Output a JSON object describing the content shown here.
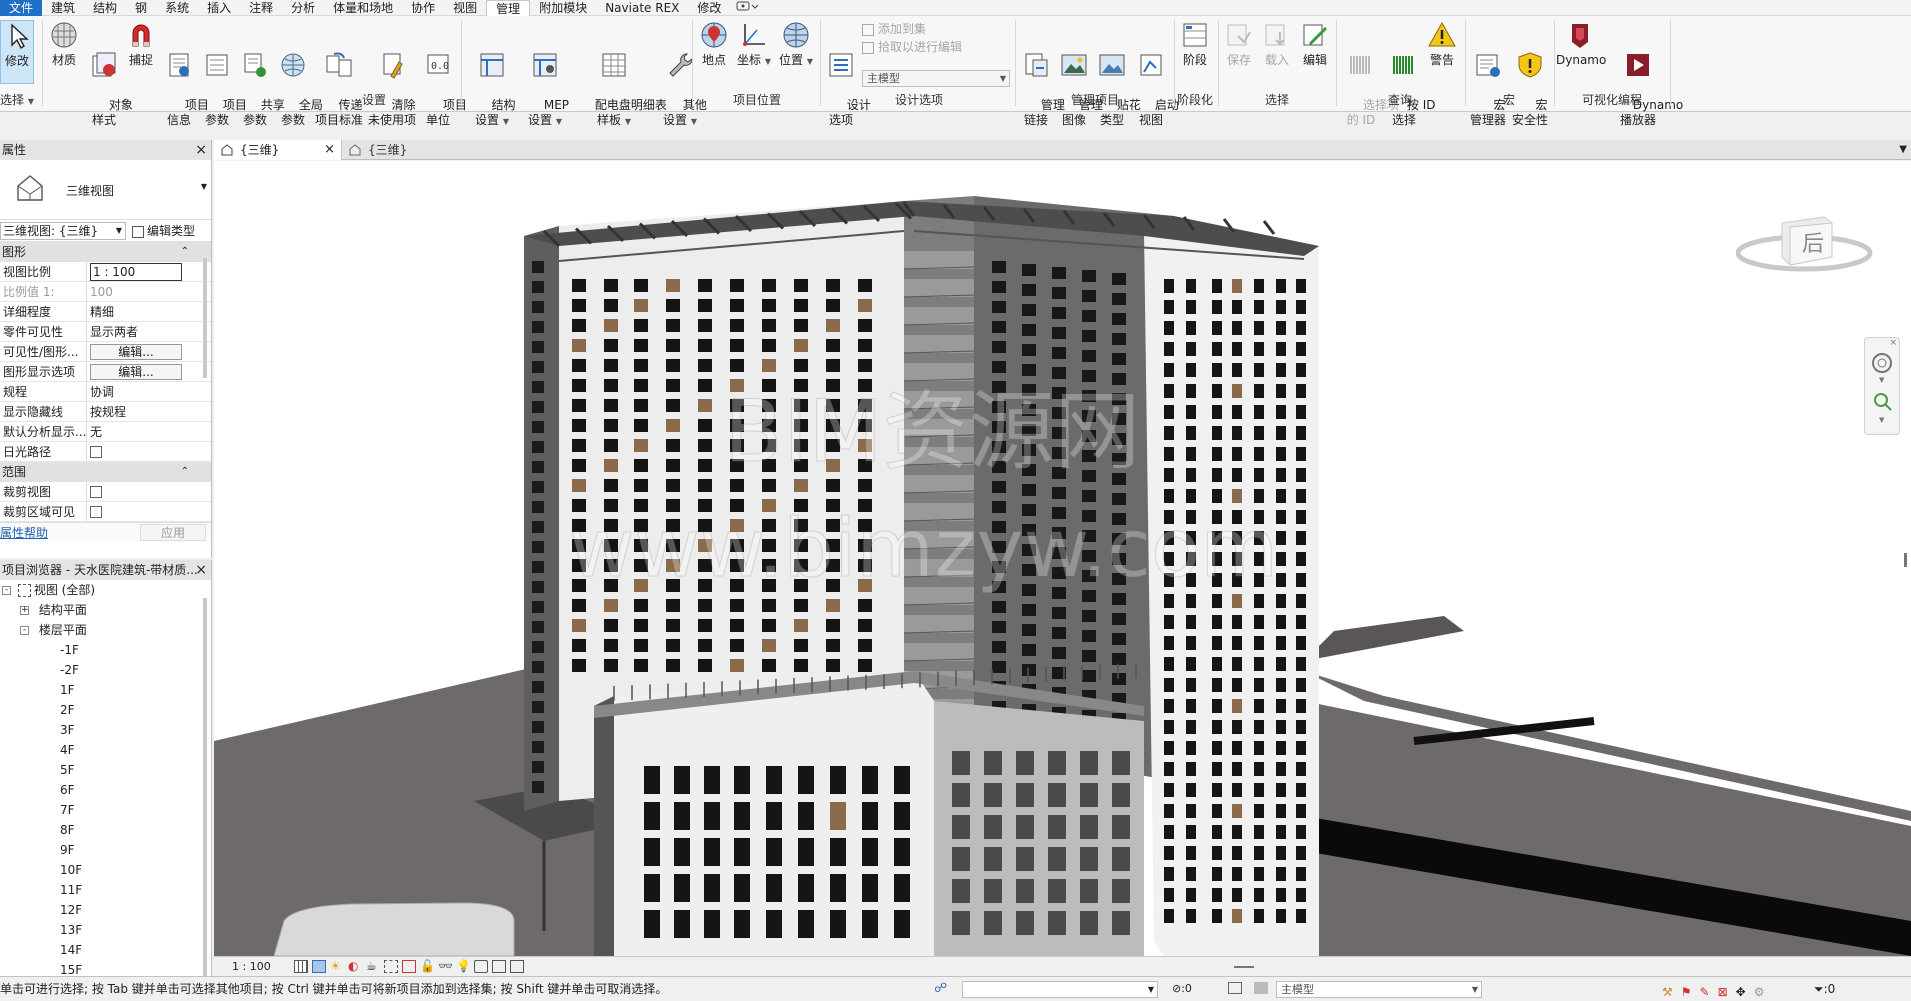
{
  "menu": {
    "tabs": [
      "文件",
      "建筑",
      "结构",
      "钢",
      "系统",
      "插入",
      "注释",
      "分析",
      "体量和场地",
      "协作",
      "视图",
      "管理",
      "附加模块",
      "Naviate REX",
      "修改"
    ],
    "active_tab": "管理"
  },
  "ribbon": {
    "select": {
      "modify": "修改",
      "group": "选择"
    },
    "settings": {
      "buttons": {
        "material": "材质",
        "object_style": "对象\n样式",
        "snap": "捕捉",
        "project_info": "项目\n信息",
        "project_params": "项目\n参数",
        "shared_params": "共享\n参数",
        "global_params": "全局\n参数",
        "transfer_standards": "传递\n项目标准",
        "purge_unused": "清除\n未使用项",
        "project_units": "项目\n单位",
        "structural_settings": "结构\n设置",
        "mep_settings": "MEP\n设置",
        "panel_schedule": "配电盘明细表\n样板",
        "other_settings": "其他\n设置"
      },
      "group": "设置"
    },
    "project_location": {
      "buttons": {
        "location": "地点",
        "coordinates": "坐标",
        "position": "位置"
      },
      "group": "项目位置"
    },
    "design_options": {
      "options": "设计\n选项",
      "add_to_set": "添加到集",
      "pick_to_edit": "拾取以进行编辑",
      "main_model": "主模型",
      "group": "设计选项"
    },
    "manage_project": {
      "buttons": {
        "manage_links": "管理\n链接",
        "manage_images": "管理\n图像",
        "decal_types": "贴花\n类型",
        "starting_view": "启动\n视图"
      },
      "group": "管理项目"
    },
    "phasing": {
      "phases": "阶段",
      "group": "阶段化"
    },
    "selection": {
      "save": "保存",
      "load": "载入",
      "edit": "编辑",
      "group": "选择"
    },
    "inquiry": {
      "ids_of_selection": "选择项\n的 ID",
      "select_by_id": "按 ID\n选择",
      "warnings": "警告",
      "group": "查询"
    },
    "macros": {
      "macro_manager": "宏\n管理器",
      "macro_security": "宏\n安全性",
      "group": "宏"
    },
    "visual_programming": {
      "dynamo": "Dynamo",
      "dynamo_player": "Dynamo\n播放器",
      "group": "可视化编程"
    }
  },
  "view_tabs": [
    {
      "label": "{三维}",
      "active": true
    },
    {
      "label": "{三维}",
      "active": false
    }
  ],
  "properties": {
    "title": "属性",
    "type_name": "三维视图",
    "instance_selector": "三维视图: {三维}",
    "edit_type": "编辑类型",
    "sections": {
      "graphics": "图形",
      "extents": "范围"
    },
    "rows": [
      {
        "key": "视图比例",
        "value": "1 : 100"
      },
      {
        "key": "比例值 1:",
        "value": "100"
      },
      {
        "key": "详细程度",
        "value": "精细"
      },
      {
        "key": "零件可见性",
        "value": "显示两者"
      },
      {
        "key": "可见性/图形...",
        "value": "编辑..."
      },
      {
        "key": "图形显示选项",
        "value": "编辑..."
      },
      {
        "key": "规程",
        "value": "协调"
      },
      {
        "key": "显示隐藏线",
        "value": "按规程"
      },
      {
        "key": "默认分析显示...",
        "value": "无"
      },
      {
        "key": "日光路径",
        "value": ""
      }
    ],
    "extent_rows": [
      {
        "key": "裁剪视图",
        "value": ""
      },
      {
        "key": "裁剪区域可见",
        "value": ""
      }
    ],
    "help": "属性帮助",
    "apply": "应用"
  },
  "browser": {
    "title": "项目浏览器 - 天水医院建筑-带材质...",
    "root": "视图 (全部)",
    "structural_plans": "结构平面",
    "floor_plans": "楼层平面",
    "levels": [
      "-1F",
      "-2F",
      "1F",
      "2F",
      "3F",
      "4F",
      "5F",
      "6F",
      "7F",
      "8F",
      "9F",
      "10F",
      "11F",
      "12F",
      "13F",
      "14F",
      "15F"
    ]
  },
  "canvas": {
    "watermark_line1": "BIM资源网",
    "watermark_line2": "www.bimzyw.com",
    "viewcube_face": "后"
  },
  "view_control": {
    "scale": "1 : 100"
  },
  "status": {
    "hint": "单击可进行选择; 按 Tab 键并单击可选择其他项目; 按 Ctrl 键并单击可将新项目添加到选择集; 按 Shift 键并单击可取消选择。",
    "zero_a": ":0",
    "main_model": "主模型",
    "filter_count": ":0"
  },
  "colors": {
    "file_tab": "#1e6fc8",
    "ground": "#6e6a6a",
    "facade": "#8c8c8c",
    "window": "#151515",
    "white_wall": "#f1f1f1"
  }
}
